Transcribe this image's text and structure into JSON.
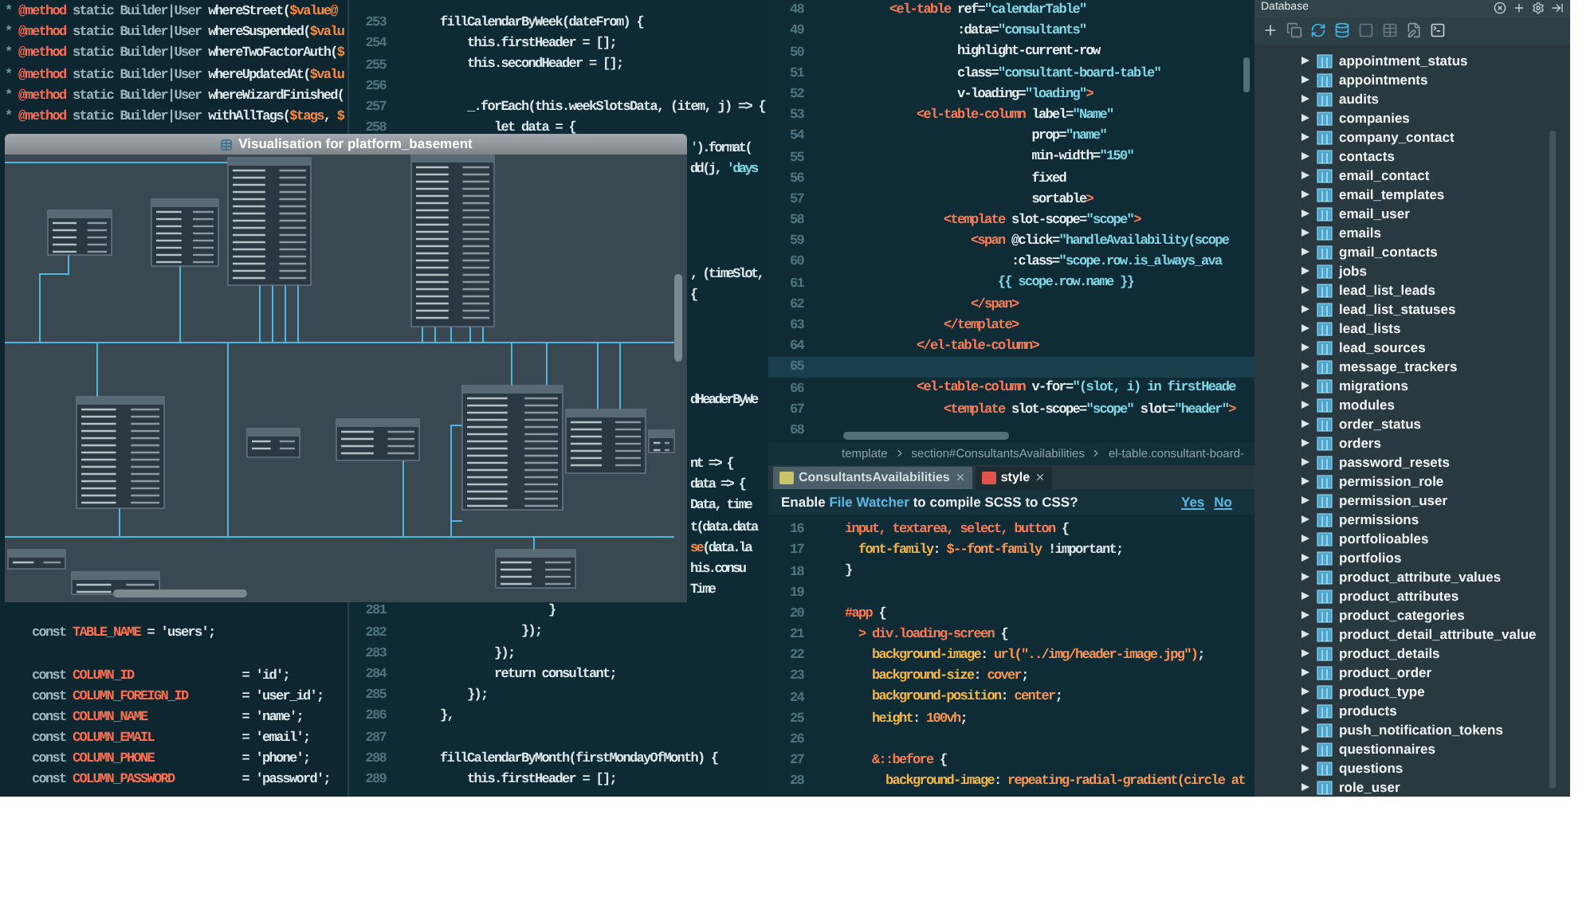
{
  "left_editor": {
    "top_lines": [
      {
        "code": [
          {
            "kind": "comment",
            "text": "* "
          },
          {
            "kind": "annotation",
            "text": "@method"
          },
          {
            "kind": "keyword",
            "text": " static Builder|User "
          },
          {
            "kind": "plain",
            "text": "whereStreet("
          },
          {
            "kind": "var",
            "text": "$value@"
          }
        ]
      },
      {
        "code": [
          {
            "kind": "comment",
            "text": "* "
          },
          {
            "kind": "annotation",
            "text": "@method"
          },
          {
            "kind": "keyword",
            "text": " static Builder|User "
          },
          {
            "kind": "plain",
            "text": "whereSuspended("
          },
          {
            "kind": "var",
            "text": "$valu"
          }
        ]
      },
      {
        "code": [
          {
            "kind": "comment",
            "text": "* "
          },
          {
            "kind": "annotation",
            "text": "@method"
          },
          {
            "kind": "keyword",
            "text": " static Builder|User "
          },
          {
            "kind": "plain",
            "text": "whereTwoFactorAuth("
          },
          {
            "kind": "var",
            "text": "$"
          }
        ]
      },
      {
        "code": [
          {
            "kind": "comment",
            "text": "* "
          },
          {
            "kind": "annotation",
            "text": "@method"
          },
          {
            "kind": "keyword",
            "text": " static Builder|User "
          },
          {
            "kind": "plain",
            "text": "whereUpdatedAt("
          },
          {
            "kind": "var",
            "text": "$valu"
          }
        ]
      },
      {
        "code": [
          {
            "kind": "comment",
            "text": "* "
          },
          {
            "kind": "annotation",
            "text": "@method"
          },
          {
            "kind": "keyword",
            "text": " static Builder|User "
          },
          {
            "kind": "plain",
            "text": "whereWizardFinished("
          }
        ]
      },
      {
        "code": [
          {
            "kind": "comment",
            "text": "* "
          },
          {
            "kind": "annotation",
            "text": "@method"
          },
          {
            "kind": "keyword",
            "text": " static Builder|User "
          },
          {
            "kind": "plain",
            "text": "withAllTags("
          },
          {
            "kind": "var",
            "text": "$tags"
          },
          {
            "kind": "plain",
            "text": ", "
          },
          {
            "kind": "var",
            "text": "$"
          }
        ]
      }
    ],
    "bottom_lines": [
      {
        "kind": "code",
        "code": [
          {
            "kind": "keyword",
            "text": "    const "
          },
          {
            "kind": "name",
            "text": "TABLE_NAME"
          },
          {
            "kind": "plain",
            "text": " = 'users';"
          }
        ]
      },
      {
        "kind": "blank"
      },
      {
        "kind": "code",
        "code": [
          {
            "kind": "keyword",
            "text": "    const "
          },
          {
            "kind": "name",
            "text": "COLUMN_ID"
          },
          {
            "kind": "plain",
            "text": "                = 'id';"
          }
        ]
      },
      {
        "kind": "code",
        "code": [
          {
            "kind": "keyword",
            "text": "    const "
          },
          {
            "kind": "name",
            "text": "COLUMN_FOREIGN_ID"
          },
          {
            "kind": "plain",
            "text": "        = 'user_id';"
          }
        ]
      },
      {
        "kind": "code",
        "code": [
          {
            "kind": "keyword",
            "text": "    const "
          },
          {
            "kind": "name",
            "text": "COLUMN_NAME"
          },
          {
            "kind": "plain",
            "text": "              = 'name';"
          }
        ]
      },
      {
        "kind": "code",
        "code": [
          {
            "kind": "keyword",
            "text": "    const "
          },
          {
            "kind": "name",
            "text": "COLUMN_EMAIL"
          },
          {
            "kind": "plain",
            "text": "             = 'email';"
          }
        ]
      },
      {
        "kind": "code",
        "code": [
          {
            "kind": "keyword",
            "text": "    const "
          },
          {
            "kind": "name",
            "text": "COLUMN_PHONE"
          },
          {
            "kind": "plain",
            "text": "             = 'phone';"
          }
        ]
      },
      {
        "kind": "code",
        "code": [
          {
            "kind": "keyword",
            "text": "    const "
          },
          {
            "kind": "name",
            "text": "COLUMN_PASSWORD"
          },
          {
            "kind": "plain",
            "text": "          = 'password';"
          }
        ]
      }
    ]
  },
  "middle_editor": {
    "lines": [
      {
        "kind": "line",
        "number": "253",
        "code": [
          {
            "kind": "plain",
            "text": "    fillCalendarByWeek(dateFrom) {"
          }
        ]
      },
      {
        "kind": "line",
        "number": "254",
        "code": [
          {
            "kind": "plain",
            "text": "        this.firstHeader = [];"
          }
        ]
      },
      {
        "kind": "line",
        "number": "255",
        "code": [
          {
            "kind": "plain",
            "text": "        this.secondHeader = [];"
          }
        ]
      },
      {
        "kind": "line",
        "number": "256"
      },
      {
        "kind": "line",
        "number": "257",
        "code": [
          {
            "kind": "plain",
            "text": "        _.forEach(this.weekSlotsData, (item, j) => {"
          }
        ]
      },
      {
        "kind": "line",
        "number": "258",
        "code": [
          {
            "kind": "plain",
            "text": "            let data = {"
          }
        ]
      },
      {
        "kind": "fragment",
        "code": [
          {
            "kind": "string",
            "text": "'"
          },
          {
            "kind": "plain",
            "text": ").format("
          }
        ]
      },
      {
        "kind": "fragment",
        "code": [
          {
            "kind": "plain",
            "text": "dd(j, "
          },
          {
            "kind": "string",
            "text": "'days"
          }
        ]
      },
      {
        "kind": "hidden"
      },
      {
        "kind": "hidden"
      },
      {
        "kind": "hidden"
      },
      {
        "kind": "hidden"
      },
      {
        "kind": "fragment",
        "code": [
          {
            "kind": "plain",
            "text": ", (timeSlot,"
          }
        ]
      },
      {
        "kind": "fragment",
        "code": [
          {
            "kind": "plain",
            "text": "{"
          }
        ]
      },
      {
        "kind": "hidden"
      },
      {
        "kind": "hidden"
      },
      {
        "kind": "hidden"
      },
      {
        "kind": "hidden"
      },
      {
        "kind": "fragment",
        "code": [
          {
            "kind": "plain",
            "text": "dHeaderByWe"
          }
        ]
      },
      {
        "kind": "hidden"
      },
      {
        "kind": "hidden"
      },
      {
        "kind": "fragment",
        "code": [
          {
            "kind": "plain",
            "text": "nt => {"
          }
        ]
      },
      {
        "kind": "fragment",
        "code": [
          {
            "kind": "plain",
            "text": "data => {"
          }
        ]
      },
      {
        "kind": "fragment",
        "code": [
          {
            "kind": "plain",
            "text": "Data, time"
          }
        ]
      },
      {
        "kind": "fragment",
        "code": [
          {
            "kind": "plain",
            "text": "t(data.data"
          }
        ]
      },
      {
        "kind": "fragment",
        "code": [
          {
            "kind": "var",
            "text": "se"
          },
          {
            "kind": "plain",
            "text": "(data.la"
          }
        ]
      },
      {
        "kind": "fragment",
        "code": [
          {
            "kind": "plain",
            "text": "his.consu"
          }
        ]
      },
      {
        "kind": "fragment",
        "code": [
          {
            "kind": "plain",
            "text": "Time"
          }
        ]
      },
      {
        "kind": "line",
        "number": "281",
        "code": [
          {
            "kind": "plain",
            "text": "                    }"
          }
        ]
      },
      {
        "kind": "line",
        "number": "282",
        "code": [
          {
            "kind": "plain",
            "text": "                });"
          }
        ]
      },
      {
        "kind": "line",
        "number": "283",
        "code": [
          {
            "kind": "plain",
            "text": "            });"
          }
        ]
      },
      {
        "kind": "line",
        "number": "284",
        "code": [
          {
            "kind": "plain",
            "text": "            return consultant;"
          }
        ]
      },
      {
        "kind": "line",
        "number": "285",
        "code": [
          {
            "kind": "plain",
            "text": "        });"
          }
        ]
      },
      {
        "kind": "line",
        "number": "286",
        "code": [
          {
            "kind": "plain",
            "text": "    },"
          }
        ]
      },
      {
        "kind": "line",
        "number": "287"
      },
      {
        "kind": "line",
        "number": "288",
        "code": [
          {
            "kind": "plain",
            "text": "    fillCalendarByMonth(firstMondayOfMonth) {"
          }
        ]
      },
      {
        "kind": "line",
        "number": "289",
        "code": [
          {
            "kind": "plain",
            "text": "        this.firstHeader = [];"
          }
        ]
      }
    ]
  },
  "template_editor": {
    "lines": [
      {
        "number": "48",
        "current": false,
        "code": [
          {
            "kind": "tag",
            "text": "        <el-table"
          },
          {
            "kind": "attr",
            "text": " ref="
          },
          {
            "kind": "string",
            "text": "\"calendarTable\""
          }
        ]
      },
      {
        "number": "49",
        "current": false,
        "code": [
          {
            "kind": "attr",
            "text": "                  :data="
          },
          {
            "kind": "string",
            "text": "\"consultants\""
          }
        ]
      },
      {
        "number": "50",
        "current": false,
        "code": [
          {
            "kind": "attr",
            "text": "                  highlight-current-row"
          }
        ]
      },
      {
        "number": "51",
        "current": false,
        "code": [
          {
            "kind": "attr",
            "text": "                  class="
          },
          {
            "kind": "string",
            "text": "\"consultant-board-table\""
          }
        ]
      },
      {
        "number": "52",
        "current": false,
        "code": [
          {
            "kind": "attr",
            "text": "                  v-loading="
          },
          {
            "kind": "string",
            "text": "\"loading\""
          },
          {
            "kind": "tag",
            "text": ">"
          }
        ]
      },
      {
        "number": "53",
        "current": false,
        "code": [
          {
            "kind": "tag",
            "text": "            <el-table-column"
          },
          {
            "kind": "attr",
            "text": " label="
          },
          {
            "kind": "string",
            "text": "\"Name\""
          }
        ]
      },
      {
        "number": "54",
        "current": false,
        "code": [
          {
            "kind": "attr",
            "text": "                             prop="
          },
          {
            "kind": "string",
            "text": "\"name\""
          }
        ]
      },
      {
        "number": "55",
        "current": false,
        "code": [
          {
            "kind": "attr",
            "text": "                             min-width="
          },
          {
            "kind": "string",
            "text": "\"150\""
          }
        ]
      },
      {
        "number": "56",
        "current": false,
        "code": [
          {
            "kind": "attr",
            "text": "                             fixed"
          }
        ]
      },
      {
        "number": "57",
        "current": false,
        "code": [
          {
            "kind": "attr",
            "text": "                             sortable"
          },
          {
            "kind": "tag",
            "text": ">"
          }
        ]
      },
      {
        "number": "58",
        "current": false,
        "code": [
          {
            "kind": "tag",
            "text": "                <template"
          },
          {
            "kind": "attr",
            "text": " slot-scope="
          },
          {
            "kind": "string",
            "text": "\"scope\""
          },
          {
            "kind": "tag",
            "text": ">"
          }
        ]
      },
      {
        "number": "59",
        "current": false,
        "code": [
          {
            "kind": "tag",
            "text": "                    <span"
          },
          {
            "kind": "attr",
            "text": " @click="
          },
          {
            "kind": "string",
            "text": "\"handleAvailability(scope"
          }
        ]
      },
      {
        "number": "60",
        "current": false,
        "code": [
          {
            "kind": "attr",
            "text": "                          :class="
          },
          {
            "kind": "string",
            "text": "\"scope.row.is_always_ava"
          }
        ]
      },
      {
        "number": "61",
        "current": false,
        "code": [
          {
            "kind": "string",
            "text": "                        {{ scope.row.name }}"
          }
        ]
      },
      {
        "number": "62",
        "current": false,
        "code": [
          {
            "kind": "tag",
            "text": "                    </span>"
          }
        ]
      },
      {
        "number": "63",
        "current": false,
        "code": [
          {
            "kind": "tag",
            "text": "                </template>"
          }
        ]
      },
      {
        "number": "64",
        "current": false,
        "code": [
          {
            "kind": "tag",
            "text": "            </el-table-column>"
          }
        ]
      },
      {
        "number": "65",
        "current": true
      },
      {
        "number": "66",
        "current": false,
        "code": [
          {
            "kind": "tag",
            "text": "            <el-table-column"
          },
          {
            "kind": "attr",
            "text": " v-for="
          },
          {
            "kind": "string",
            "text": "\"(slot, i) in firstHeade"
          }
        ]
      },
      {
        "number": "67",
        "current": false,
        "code": [
          {
            "kind": "tag",
            "text": "                <template"
          },
          {
            "kind": "attr",
            "text": " slot-scope="
          },
          {
            "kind": "string",
            "text": "\"scope\""
          },
          {
            "kind": "attr",
            "text": " slot="
          },
          {
            "kind": "string",
            "text": "\"header\""
          },
          {
            "kind": "tag",
            "text": ">"
          }
        ]
      },
      {
        "number": "68",
        "current": false
      }
    ],
    "breadcrumb": [
      "template",
      "section#ConsultantsAvailabilities",
      "el-table.consultant-board-"
    ]
  },
  "tabs": [
    {
      "label": "ConsultantsAvailabilities",
      "kind": "vue",
      "selected": false
    },
    {
      "label": "style",
      "kind": "style",
      "selected": true
    }
  ],
  "notification": {
    "message": "Enable **File Watcher** to compile SCSS to CSS?",
    "actions": [
      "Yes",
      "No"
    ]
  },
  "style_editor": {
    "lines": [
      {
        "number": "16",
        "code": [
          {
            "kind": "selector",
            "text": "input, textarea, select, button"
          },
          {
            "kind": "plain",
            "text": " {"
          }
        ]
      },
      {
        "number": "17",
        "code": [
          {
            "kind": "property",
            "text": "  font-family"
          },
          {
            "kind": "plain",
            "text": ": "
          },
          {
            "kind": "value",
            "text": "$--font-family"
          },
          {
            "kind": "plain",
            "text": " !important;"
          }
        ]
      },
      {
        "number": "18",
        "code": [
          {
            "kind": "plain",
            "text": "}"
          }
        ]
      },
      {
        "number": "19"
      },
      {
        "number": "20",
        "code": [
          {
            "kind": "selector",
            "text": "#app"
          },
          {
            "kind": "plain",
            "text": " {"
          }
        ]
      },
      {
        "number": "21",
        "code": [
          {
            "kind": "selector",
            "text": "  > div.loading-screen"
          },
          {
            "kind": "plain",
            "text": " {"
          }
        ]
      },
      {
        "number": "22",
        "code": [
          {
            "kind": "property",
            "text": "    background-image"
          },
          {
            "kind": "plain",
            "text": ": "
          },
          {
            "kind": "value",
            "text": "url(\"../img/header-image.jpg\")"
          },
          {
            "kind": "plain",
            "text": ";"
          }
        ]
      },
      {
        "number": "23",
        "code": [
          {
            "kind": "property",
            "text": "    background-size"
          },
          {
            "kind": "plain",
            "text": ": "
          },
          {
            "kind": "value",
            "text": "cover"
          },
          {
            "kind": "plain",
            "text": ";"
          }
        ]
      },
      {
        "number": "24",
        "code": [
          {
            "kind": "property",
            "text": "    background-position"
          },
          {
            "kind": "plain",
            "text": ": "
          },
          {
            "kind": "value",
            "text": "center"
          },
          {
            "kind": "plain",
            "text": ";"
          }
        ]
      },
      {
        "number": "25",
        "code": [
          {
            "kind": "property",
            "text": "    height"
          },
          {
            "kind": "plain",
            "text": ": "
          },
          {
            "kind": "value",
            "text": "100vh"
          },
          {
            "kind": "plain",
            "text": ";"
          }
        ]
      },
      {
        "number": "26"
      },
      {
        "number": "27",
        "code": [
          {
            "kind": "selector",
            "text": "    &::before"
          },
          {
            "kind": "plain",
            "text": " {"
          }
        ]
      },
      {
        "number": "28",
        "code": [
          {
            "kind": "property",
            "text": "      background-image"
          },
          {
            "kind": "plain",
            "text": ": "
          },
          {
            "kind": "value",
            "text": "repeating-radial-gradient(circle at"
          }
        ]
      }
    ]
  },
  "diagram_window": {
    "title": "Visualisation for platform_basement"
  },
  "database": {
    "title": "Database",
    "tables": [
      {
        "name": "appointment_status",
        "expanded": false
      },
      {
        "name": "appointments",
        "expanded": false
      },
      {
        "name": "audits",
        "expanded": false
      },
      {
        "name": "companies",
        "expanded": false
      },
      {
        "name": "company_contact",
        "expanded": false
      },
      {
        "name": "contacts",
        "expanded": false
      },
      {
        "name": "email_contact",
        "expanded": false
      },
      {
        "name": "email_templates",
        "expanded": false
      },
      {
        "name": "email_user",
        "expanded": false
      },
      {
        "name": "emails",
        "expanded": false
      },
      {
        "name": "gmail_contacts",
        "expanded": false
      },
      {
        "name": "jobs",
        "expanded": false
      },
      {
        "name": "lead_list_leads",
        "expanded": false
      },
      {
        "name": "lead_list_statuses",
        "expanded": false
      },
      {
        "name": "lead_lists",
        "expanded": false
      },
      {
        "name": "lead_sources",
        "expanded": false
      },
      {
        "name": "message_trackers",
        "expanded": false
      },
      {
        "name": "migrations",
        "expanded": false
      },
      {
        "name": "modules",
        "expanded": false
      },
      {
        "name": "order_status",
        "expanded": false
      },
      {
        "name": "orders",
        "expanded": false
      },
      {
        "name": "password_resets",
        "expanded": false
      },
      {
        "name": "permission_role",
        "expanded": false
      },
      {
        "name": "permission_user",
        "expanded": false
      },
      {
        "name": "permissions",
        "expanded": false
      },
      {
        "name": "portfolioables",
        "expanded": false
      },
      {
        "name": "portfolios",
        "expanded": false
      },
      {
        "name": "product_attribute_values",
        "expanded": false
      },
      {
        "name": "product_attributes",
        "expanded": false
      },
      {
        "name": "product_categories",
        "expanded": false
      },
      {
        "name": "product_detail_attribute_value",
        "expanded": false
      },
      {
        "name": "product_details",
        "expanded": false
      },
      {
        "name": "product_order",
        "expanded": false
      },
      {
        "name": "product_type",
        "expanded": false
      },
      {
        "name": "products",
        "expanded": false
      },
      {
        "name": "push_notification_tokens",
        "expanded": false
      },
      {
        "name": "questionnaires",
        "expanded": false
      },
      {
        "name": "questions",
        "expanded": false
      },
      {
        "name": "role_user",
        "expanded": false
      }
    ]
  }
}
